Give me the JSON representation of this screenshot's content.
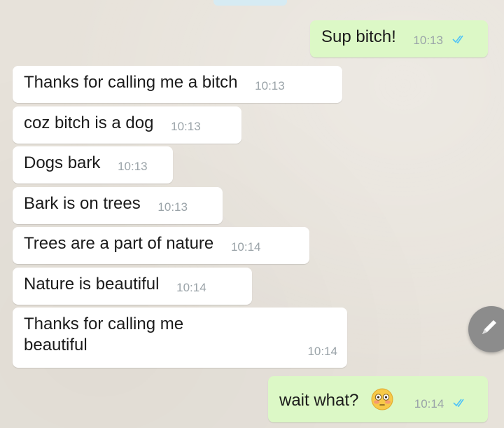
{
  "chat": {
    "messages": [
      {
        "text": "Sup bitch!",
        "time": "10:13",
        "direction": "outgoing",
        "ticks": "double-check-icon"
      },
      {
        "text": "Thanks for calling me a bitch",
        "time": "10:13",
        "direction": "incoming"
      },
      {
        "text": "coz bitch is a dog",
        "time": "10:13",
        "direction": "incoming"
      },
      {
        "text": "Dogs bark",
        "time": "10:13",
        "direction": "incoming"
      },
      {
        "text": "Bark is on trees",
        "time": "10:13",
        "direction": "incoming"
      },
      {
        "text": "Trees are a part of nature",
        "time": "10:14",
        "direction": "incoming"
      },
      {
        "text": "Nature is beautiful",
        "time": "10:14",
        "direction": "incoming"
      },
      {
        "text": "Thanks for calling me beautiful",
        "time": "10:14",
        "direction": "incoming"
      },
      {
        "text": "wait what?",
        "time": "10:14",
        "direction": "outgoing",
        "ticks": "double-check-icon",
        "emoji": "flushed-face-emoji"
      }
    ]
  },
  "colors": {
    "outgoing_bubble": "#dcf8c6",
    "incoming_bubble": "#ffffff",
    "background": "#e7e2da",
    "tick": "#4fc3f7",
    "timestamp": "#9aa3a8"
  },
  "fab": {
    "icon": "pencil-icon"
  }
}
